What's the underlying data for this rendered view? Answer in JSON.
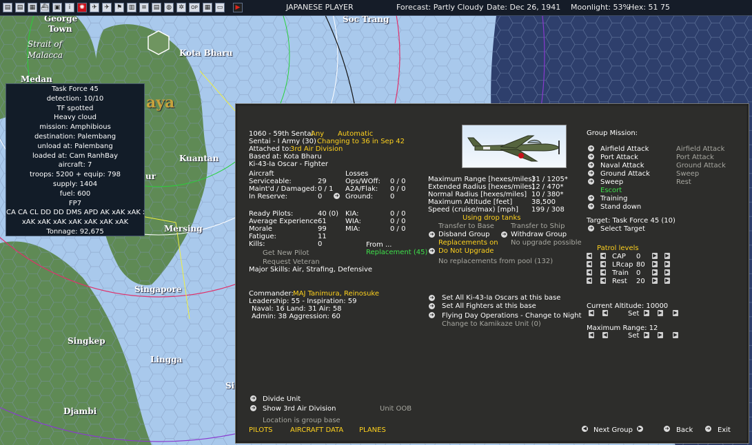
{
  "status_bar": {
    "player": "JAPANESE PLAYER",
    "forecast": "Forecast: Partly Cloudy",
    "date": "Date: Dec 26, 1941",
    "moonlight": "Moonlight: 53%",
    "hex": "Hex: 51 75"
  },
  "map_labels": {
    "george_town_1": "George",
    "george_town_2": "Town",
    "strait_1": "Strait of",
    "strait_2": "Malacca",
    "kota_bharu": "Kota Bharu",
    "soc_trang": "Soc Trang",
    "medan": "Medan",
    "malaya": "aya",
    "kuantan": "Kuantan",
    "mersing": "Mersing",
    "singapore": "Singapore",
    "singkep": "Singkep",
    "lingga": "Lingga",
    "djambi": "Djambi",
    "si": "Si",
    "ur": "ur"
  },
  "task_force_box": {
    "lines": [
      "Task Force 45",
      "detection: 10/10",
      "TF spotted",
      "Heavy cloud",
      "mission: Amphibious",
      "destination: Palembang",
      "unload at: Palembang",
      "loaded at: Cam RanhBay",
      "aircraft: 7",
      "troops: 5200 + equip: 798",
      "supply: 1404",
      "fuel: 600",
      "FP7",
      "CA CA CL DD DD DMS APD AK xAK xAK xAK",
      "xAK xAK xAK xAK xAK xAK xAK",
      "Tonnage: 92,675"
    ]
  },
  "unit": {
    "name": "1060 - 59th Sentai",
    "any": "Any",
    "automatic": "Automatic",
    "sentai": "Sentai - I Army (30)",
    "changing": "Changing to 36 in Sep 42",
    "attached_label": "Attached to:",
    "attached_value": "3rd Air Division",
    "based": "Based at: Kota Bharu",
    "aircraft_type": "Ki-43-Ia Oscar - Fighter"
  },
  "aircraft_stats": {
    "header": "Aircraft",
    "rows": [
      {
        "label": "Serviceable:",
        "value": "29"
      },
      {
        "label": "Maint'd / Damaged:",
        "value": "0 / 1"
      },
      {
        "label": "In Reserve:",
        "value": "0"
      }
    ]
  },
  "losses": {
    "header": "Losses",
    "rows": [
      {
        "label": "Ops/WOff:",
        "value": "0 / 0"
      },
      {
        "label": "A2A/Flak:",
        "value": "0 / 0"
      },
      {
        "label": "Ground:",
        "value": "0"
      }
    ]
  },
  "pilot_stats": {
    "rows": [
      {
        "label": "Ready Pilots:",
        "value": "40 (0)"
      },
      {
        "label": "Average Experience",
        "value": "61"
      },
      {
        "label": "Morale",
        "value": "99"
      },
      {
        "label": "Fatigue:",
        "value": "11"
      },
      {
        "label": "Kills:",
        "value": "0"
      }
    ],
    "kia": [
      {
        "label": "KIA:",
        "value": "0 / 0"
      },
      {
        "label": "WIA:",
        "value": "0 / 0"
      },
      {
        "label": "MIA:",
        "value": "0 / 0"
      }
    ],
    "get_new_pilot": "Get New Pilot",
    "request_veteran": "Request Veteran",
    "major_skills": "Major Skills: Air, Strafing, Defensive",
    "from": "From ...",
    "replacement": "Replacement (45)"
  },
  "performance": {
    "rows": [
      {
        "label": "Maximum Range [hexes/miles]",
        "value": "31 / 1205*"
      },
      {
        "label": "Extended Radius [hexes/miles]",
        "value": "12 / 470*"
      },
      {
        "label": "Normal Radius [hexes/miles]",
        "value": "10 / 380*"
      },
      {
        "label": "Maximum Altitude [feet]",
        "value": "38,500"
      },
      {
        "label": "Speed (cruise/max) [mph]",
        "value": "199 / 308"
      }
    ],
    "drop_tanks": "Using drop tanks"
  },
  "group_actions": {
    "transfer_base": "Transfer to Base",
    "transfer_ship": "Transfer to Ship",
    "disband": "Disband Group",
    "withdraw": "Withdraw Group",
    "replacements_on": "Replacements on",
    "no_upgrade_possible": "No upgrade possible",
    "do_not_upgrade": "Do Not Upgrade",
    "no_replacements": "No replacements from pool (132)"
  },
  "commander": {
    "label": "Commander:",
    "name": "MAJ Tanimura, Reinosuke",
    "leadership": "Leadership: 55 - Inspiration: 59",
    "skills": "Naval: 16  Land: 31  Air: 58",
    "admin": "Admin: 38  Aggression: 60"
  },
  "base_actions": {
    "set_all_type": "Set All Ki-43-Ia Oscars at this base",
    "set_all_fighters": "Set All Fighters at this base",
    "flying_day": "Flying Day Operations - Change to Night",
    "kamikaze": "Change to Kamikaze Unit (0)"
  },
  "group_mission": {
    "header": "Group Mission:",
    "missions": [
      "Airfield Attack",
      "Port Attack",
      "Naval Attack",
      "Ground Attack",
      "Sweep",
      "Escort",
      "Training",
      "Stand down"
    ],
    "secondary": [
      "Airfield Attack",
      "Port Attack",
      "Ground Attack",
      "Sweep",
      "Rest"
    ],
    "target": "Target: Task Force 45  (10)",
    "select_target": "Select Target"
  },
  "patrol": {
    "header": "Patrol levels",
    "rows": [
      {
        "label": "CAP",
        "value": "0"
      },
      {
        "label": "LRcap",
        "value": "80"
      },
      {
        "label": "Train",
        "value": "0"
      },
      {
        "label": "Rest",
        "value": "20"
      }
    ]
  },
  "altitude": {
    "current": "Current Altitude: 10000",
    "max_range": "Maximum Range: 12",
    "set": "Set"
  },
  "footer": {
    "divide": "Divide Unit",
    "show_division": "Show 3rd Air Division",
    "unit_oob": "Unit OOB",
    "location": "Location is group base",
    "pilots": "PILOTS",
    "aircraft_data": "AIRCRAFT DATA",
    "planes": "PLANES",
    "next_group": "Next Group",
    "back": "Back",
    "exit": "Exit"
  },
  "colors": {
    "highlight_yellow": "#ffd21e",
    "active_green": "#3ee04a",
    "panel_bg": "#2d2d2b",
    "sea": "#a9c9ec",
    "deep_sea": "#2e3f6c",
    "land": "#5f8a55"
  }
}
